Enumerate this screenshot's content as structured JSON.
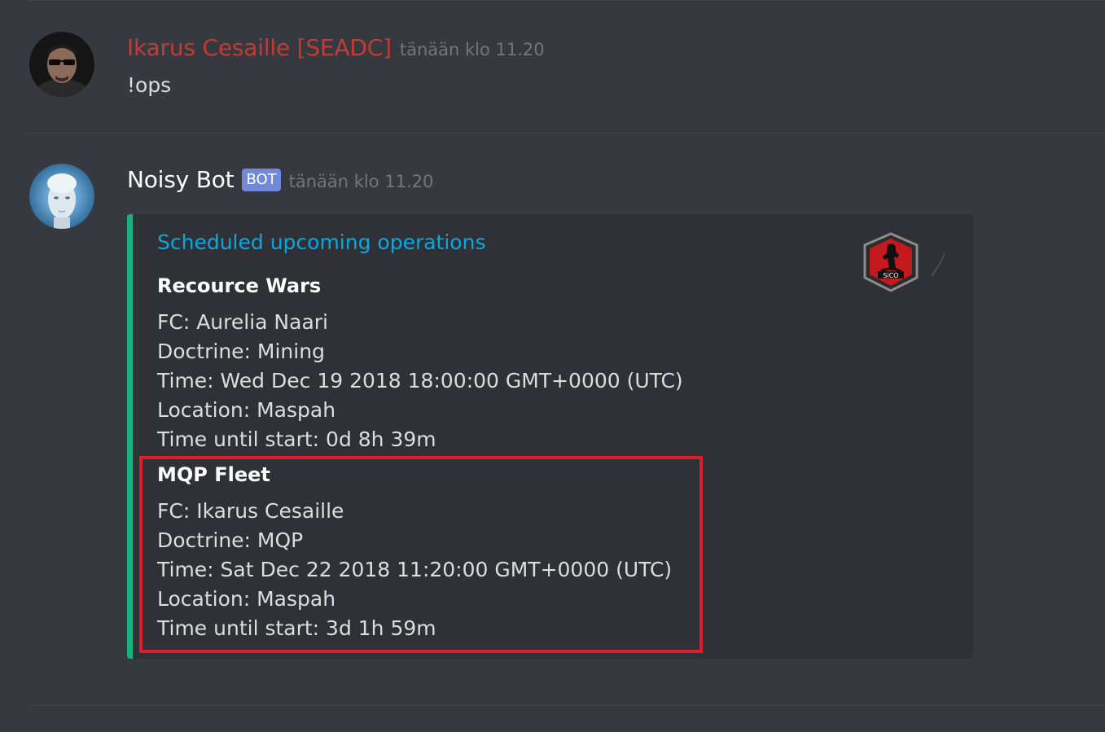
{
  "messages": [
    {
      "author": "Ikarus Cesaille [SEADC]",
      "timestamp": "tänään klo 11.20",
      "text": "!ops",
      "author_color": "#c13c34"
    },
    {
      "author": "Noisy Bot",
      "badge": "BOT",
      "timestamp": "tänään klo 11.20"
    }
  ],
  "embed": {
    "title": "Scheduled upcoming operations",
    "accent_color": "#17b07e",
    "thumbnail_icon": "sico-corp-logo",
    "fields": [
      {
        "name": "Recource Wars",
        "lines": [
          "FC: Aurelia Naari",
          "Doctrine: Mining",
          "Time: Wed Dec 19 2018 18:00:00 GMT+0000 (UTC)",
          "Location: Maspah",
          "Time until start: 0d 8h 39m"
        ]
      },
      {
        "name": "MQP Fleet",
        "lines": [
          "FC: Ikarus Cesaille",
          "Doctrine: MQP",
          "Time: Sat Dec 22 2018 11:20:00 GMT+0000 (UTC)",
          "Location: Maspah",
          "Time until start: 3d 1h 59m"
        ]
      }
    ]
  },
  "annotation": {
    "highlight_color": "#dd1f2d"
  }
}
